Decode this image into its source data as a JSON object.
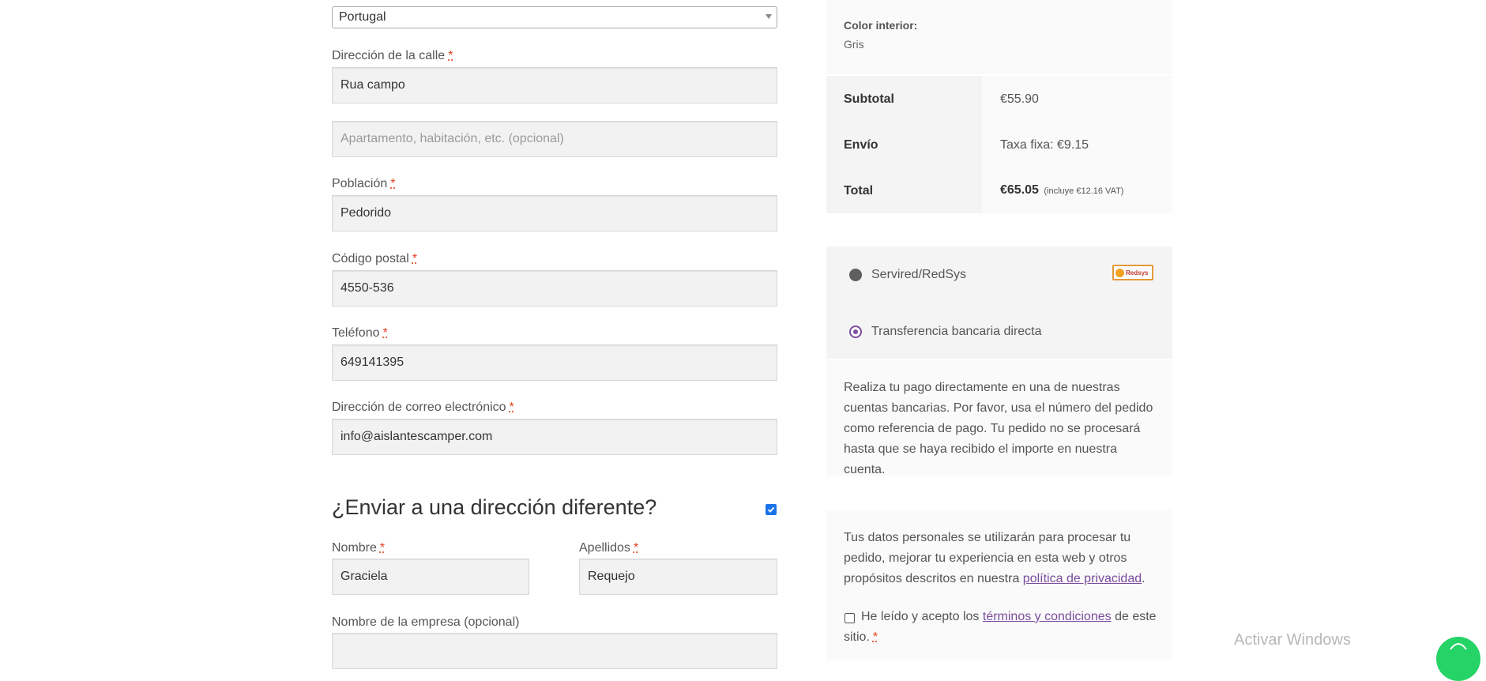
{
  "billing": {
    "country_value": "Portugal",
    "street_label": "Dirección de la calle",
    "street_value": "Rua campo",
    "apartment_placeholder": "Apartamento, habitación, etc. (opcional)",
    "city_label": "Población",
    "city_value": "Pedorido",
    "postcode_label": "Código postal",
    "postcode_value": "4550-536",
    "phone_label": "Teléfono",
    "phone_value": "649141395",
    "email_label": "Dirección de correo electrónico",
    "email_value": "info@aislantescamper.com",
    "required_mark": "*"
  },
  "shipping": {
    "heading": "¿Enviar a una dirección diferente?",
    "checked": true,
    "first_name_label": "Nombre",
    "first_name_value": "Graciela",
    "last_name_label": "Apellidos",
    "last_name_value": "Requejo",
    "company_label": "Nombre de la empresa (opcional)"
  },
  "order": {
    "meta_label": "Color interior:",
    "meta_value": "Gris",
    "subtotal_label": "Subtotal",
    "subtotal_value": "€55.90",
    "shipping_label": "Envío",
    "shipping_value": "Taxa fixa: €9.15",
    "total_label": "Total",
    "total_value": "€65.05",
    "total_tax_note": "(incluye €12.16 VAT)"
  },
  "payment": {
    "redsys_label": "Servired/RedSys",
    "redsys_logo_text": "Redsys",
    "bank_label": "Transferencia bancaria directa",
    "bank_description": "Realiza tu pago directamente en una de nuestras cuentas bancarias. Por favor, usa el número del pedido como referencia de pago. Tu pedido no se procesará hasta que se haya recibido el importe en nuestra cuenta."
  },
  "privacy": {
    "text_before": "Tus datos personales se utilizarán para procesar tu pedido, mejorar tu experiencia en esta web y otros propósitos descritos en nuestra ",
    "link_text": "política de privacidad",
    "text_after": ".",
    "terms_before": "He leído y acepto los ",
    "terms_link": "términos y condiciones",
    "terms_after": " de este sitio.",
    "terms_required": "*"
  },
  "watermark": "Activar Windows",
  "colors": {
    "accent": "#7b4c9e",
    "required": "#e2401c",
    "whatsapp": "#25d366"
  }
}
